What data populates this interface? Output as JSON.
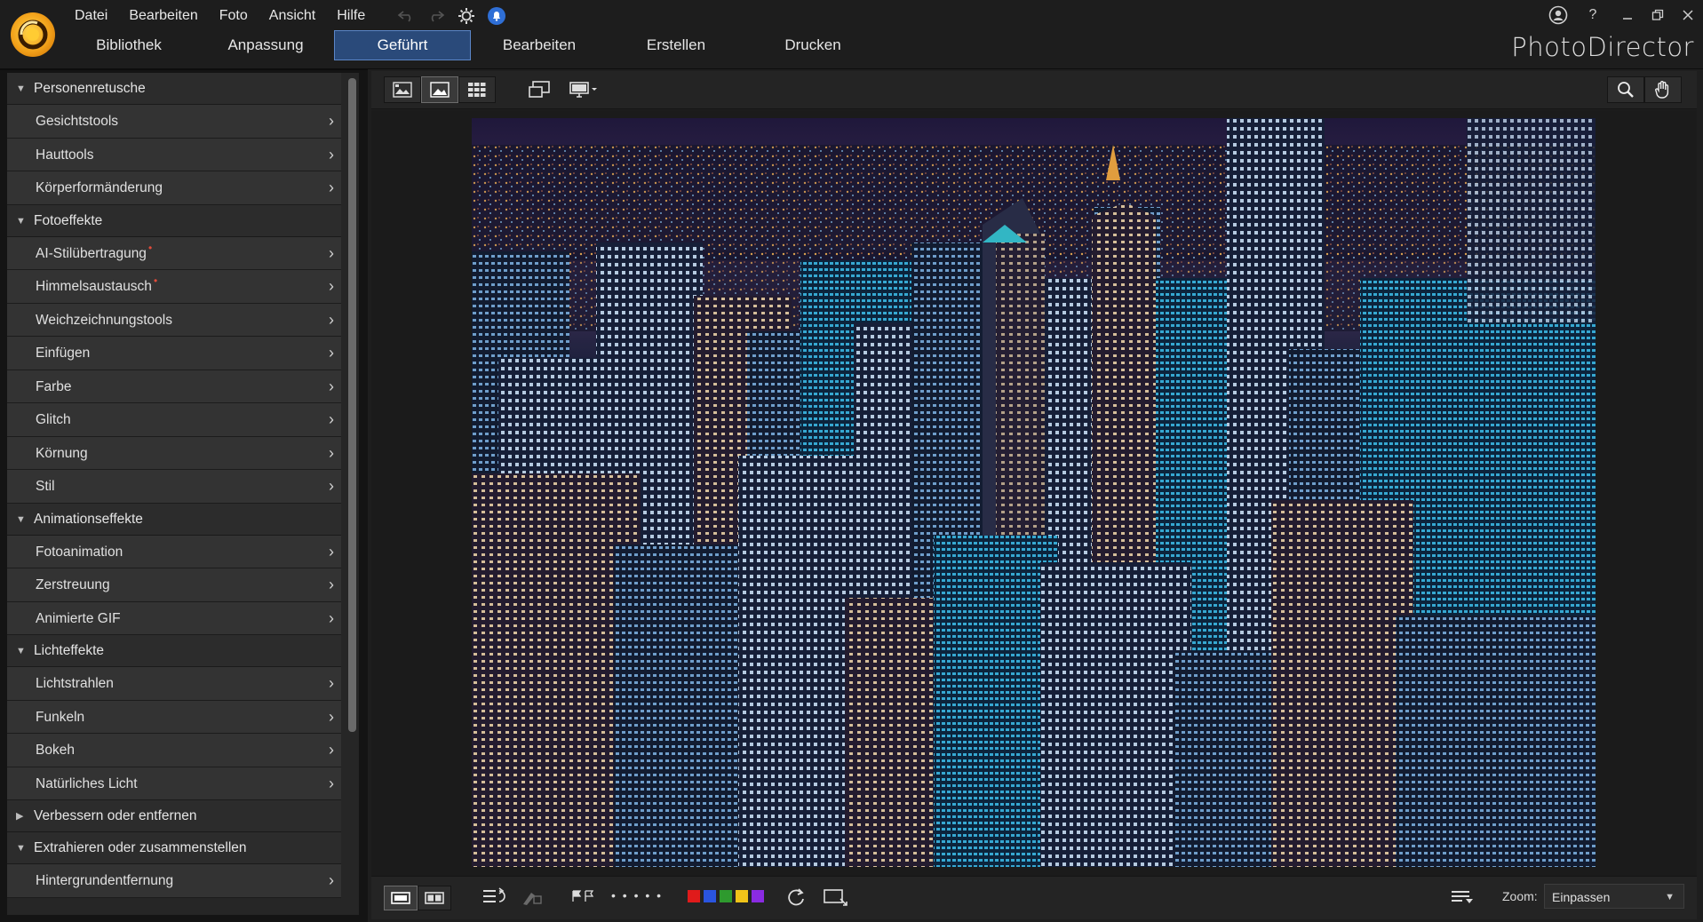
{
  "app": {
    "brand": "PhotoDirector"
  },
  "menu": [
    "Datei",
    "Bearbeiten",
    "Foto",
    "Ansicht",
    "Hilfe"
  ],
  "mode_tabs": [
    {
      "label": "Bibliothek",
      "active": false
    },
    {
      "label": "Anpassung",
      "active": false
    },
    {
      "label": "Geführt",
      "active": true
    },
    {
      "label": "Bearbeiten",
      "active": false
    },
    {
      "label": "Erstellen",
      "active": false
    },
    {
      "label": "Drucken",
      "active": false
    }
  ],
  "window_controls": {
    "help": "?"
  },
  "sidebar": {
    "categories": [
      {
        "label": "Personenretusche",
        "expanded": true,
        "items": [
          {
            "label": "Gesichtstools"
          },
          {
            "label": "Hauttools"
          },
          {
            "label": "Körperformänderung"
          }
        ]
      },
      {
        "label": "Fotoeffekte",
        "expanded": true,
        "items": [
          {
            "label": "AI-Stilübertragung",
            "new": true
          },
          {
            "label": "Himmelsaustausch",
            "new": true
          },
          {
            "label": "Weichzeichnungstools"
          },
          {
            "label": "Einfügen"
          },
          {
            "label": "Farbe"
          },
          {
            "label": "Glitch"
          },
          {
            "label": "Körnung"
          },
          {
            "label": "Stil"
          }
        ]
      },
      {
        "label": "Animationseffekte",
        "expanded": true,
        "items": [
          {
            "label": "Fotoanimation"
          },
          {
            "label": "Zerstreuung"
          },
          {
            "label": "Animierte GIF"
          }
        ]
      },
      {
        "label": "Lichteffekte",
        "expanded": true,
        "items": [
          {
            "label": "Lichtstrahlen"
          },
          {
            "label": "Funkeln"
          },
          {
            "label": "Bokeh"
          },
          {
            "label": "Natürliches Licht"
          }
        ]
      },
      {
        "label": "Verbessern oder entfernen",
        "expanded": false,
        "items": []
      },
      {
        "label": "Extrahieren oder zusammenstellen",
        "expanded": true,
        "items": [
          {
            "label": "Hintergrundentfernung"
          }
        ]
      }
    ]
  },
  "viewer": {
    "zoom_label": "Zoom:",
    "zoom_value": "Einpassen",
    "flag_dots": "• • • • •",
    "color_labels": [
      "#e01b1b",
      "#2a55e0",
      "#2e9a2e",
      "#f0c419",
      "#8a2be2"
    ]
  },
  "icons": {
    "expanded": "▼",
    "collapsed": "▶",
    "chevron": "›",
    "new_marker": "•",
    "dropdown": "▼"
  }
}
